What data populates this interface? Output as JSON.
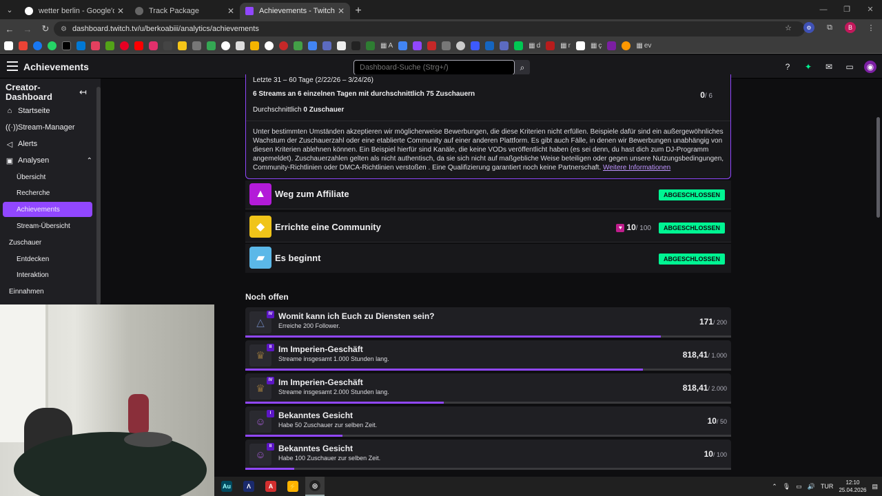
{
  "browser": {
    "tabs": [
      {
        "title": "wetter berlin - Google'da Ara",
        "favicon_color": "#ffffff"
      },
      {
        "title": "Track Package",
        "favicon_color": "#3c3c3c"
      },
      {
        "title": "Achievements - Twitch",
        "favicon_color": "#9147ff"
      }
    ],
    "url": "dashboard.twitch.tv/u/berkoabiii/analytics/achievements",
    "profile_initial": "B",
    "bookmark_folders": [
      "A",
      "d",
      "r",
      "ç",
      "ev"
    ]
  },
  "topnav": {
    "title": "Achievements",
    "search_placeholder": "Dashboard-Suche (Strg+/)"
  },
  "sidebar": {
    "heading": "Creator-Dashboard",
    "items": [
      {
        "label": "Startseite",
        "icon": "home-icon"
      },
      {
        "label": "Stream-Manager",
        "icon": "broadcast-icon"
      },
      {
        "label": "Alerts",
        "icon": "megaphone-icon"
      },
      {
        "label": "Analysen",
        "icon": "analytics-icon"
      }
    ],
    "analysen_sub": [
      "Übersicht",
      "Recherche",
      "Achievements",
      "Stream-Übersicht"
    ],
    "categories": {
      "zuschauer": "Zuschauer",
      "entdecken": "Entdecken",
      "interaktion": "Interaktion",
      "einnahmen": "Einnahmen"
    }
  },
  "info": {
    "period": "Letzte 31 – 60 Tage (2/22/26 – 3/24/26)",
    "streams_line": "6 Streams an 6 einzelnen Tagen mit durchschnittlich 75 Zuschauern",
    "streams_count": "0",
    "streams_total": "/ 6",
    "avg_label": "Durchschnittlich",
    "avg_value": "0 Zuschauer",
    "paragraph": "Unter bestimmten Umständen akzeptieren wir möglicherweise Bewerbungen, die diese Kriterien nicht erfüllen. Beispiele dafür sind ein außergewöhnliches Wachstum der Zuschauerzahl oder eine etablierte Community auf einer anderen Plattform. Es gibt auch Fälle, in denen wir Bewerbungen unabhängig von diesen Kriterien ablehnen können. Ein Beispiel hierfür sind Kanäle, die keine VODs veröffentlicht haben (es sei denn, du hast dich zum DJ-Programm angemeldet). Zuschauerzahlen gelten als nicht authentisch, da sie sich nicht auf maßgebliche Weise beteiligen oder gegen unsere Nutzungsbedingungen, Community-Richtlinien oder DMCA-Richtlinien verstoßen . Eine Qualifizierung garantiert noch keine Partnerschaft.",
    "link": "Weitere Informationen"
  },
  "completed": [
    {
      "name": "Weg zum Affiliate",
      "status": "ABGESCHLOSSEN",
      "color": "#b31bd8"
    },
    {
      "name": "Errichte eine Community",
      "status": "ABGESCHLOSSEN",
      "color": "#f0c419",
      "progress": "10",
      "total": "/ 100"
    },
    {
      "name": "Es beginnt",
      "status": "ABGESCHLOSSEN",
      "color": "#5bb8e8"
    }
  ],
  "open_heading": "Noch offen",
  "open": [
    {
      "tier": "IV",
      "title": "Womit kann ich Euch zu Diensten sein?",
      "sub": "Erreiche 200 Follower.",
      "value": "171",
      "total": "/ 200",
      "progress": 0.855
    },
    {
      "tier": "II",
      "title": "Im Imperien-Geschäft",
      "sub": "Streame insgesamt 1.000 Stunden lang.",
      "value": "818,41",
      "total": "/ 1.000",
      "progress": 0.818
    },
    {
      "tier": "IV",
      "title": "Im Imperien-Geschäft",
      "sub": "Streame insgesamt 2.000 Stunden lang.",
      "value": "818,41",
      "total": "/ 2.000",
      "progress": 0.409
    },
    {
      "tier": "I",
      "title": "Bekanntes Gesicht",
      "sub": "Habe 50 Zuschauer zur selben Zeit.",
      "value": "10",
      "total": "/ 50",
      "progress": 0.2
    },
    {
      "tier": "II",
      "title": "Bekanntes Gesicht",
      "sub": "Habe 100 Zuschauer zur selben Zeit.",
      "value": "10",
      "total": "/ 100",
      "progress": 0.1
    }
  ],
  "taskbar": {
    "lang": "TUR",
    "time": "12:10",
    "date": "25.04.2026"
  }
}
